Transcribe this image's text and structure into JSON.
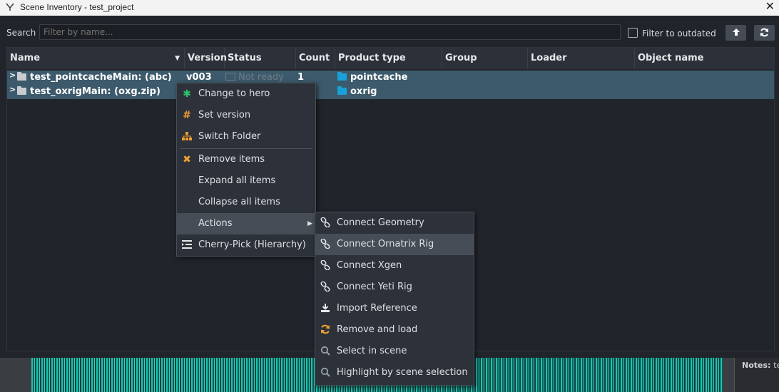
{
  "window": {
    "title": "Scene Inventory - test_project"
  },
  "toolbar": {
    "search_label": "Search",
    "search_placeholder": "Filter by name...",
    "filter_outdated_label": "Filter to outdated"
  },
  "table": {
    "columns": [
      "Name",
      "Version",
      "Status",
      "Count",
      "Product type",
      "Group",
      "Loader",
      "Object name"
    ],
    "rows": [
      {
        "name": "test_pointcacheMain: (abc)",
        "version": "v003",
        "status": "Not ready",
        "count": "1",
        "product_type": "pointcache"
      },
      {
        "name": "test_oxrigMain: (oxg.zip)",
        "product_type": "oxrig"
      }
    ]
  },
  "context_menu": {
    "items": [
      {
        "label": "Change to hero",
        "icon": "asterisk-icon"
      },
      {
        "label": "Set version",
        "icon": "hash-icon"
      },
      {
        "label": "Switch Folder",
        "icon": "hierarchy-icon"
      },
      {
        "label": "Remove items",
        "icon": "x-icon"
      },
      {
        "label": "Expand all items"
      },
      {
        "label": "Collapse all items"
      },
      {
        "label": "Actions"
      },
      {
        "label": "Cherry-Pick (Hierarchy)",
        "icon": "indent-icon"
      }
    ]
  },
  "actions_submenu": {
    "items": [
      {
        "label": "Connect Geometry",
        "icon": "link-icon"
      },
      {
        "label": "Connect Ornatrix Rig",
        "icon": "link-icon"
      },
      {
        "label": "Connect Xgen",
        "icon": "link-icon"
      },
      {
        "label": "Connect Yeti Rig",
        "icon": "link-icon"
      },
      {
        "label": "Import Reference",
        "icon": "download-icon"
      },
      {
        "label": "Remove and load",
        "icon": "refresh-icon"
      },
      {
        "label": "Select in scene",
        "icon": "search-icon"
      },
      {
        "label": "Highlight by scene selection",
        "icon": "search-icon"
      }
    ]
  },
  "notes": {
    "label": "Notes:",
    "value": "tes"
  },
  "colors": {
    "selected_row": "#3c5a6b",
    "folder_blue": "#1aa0d8",
    "accent_green": "#2ec26a",
    "accent_orange": "#f0a030"
  }
}
